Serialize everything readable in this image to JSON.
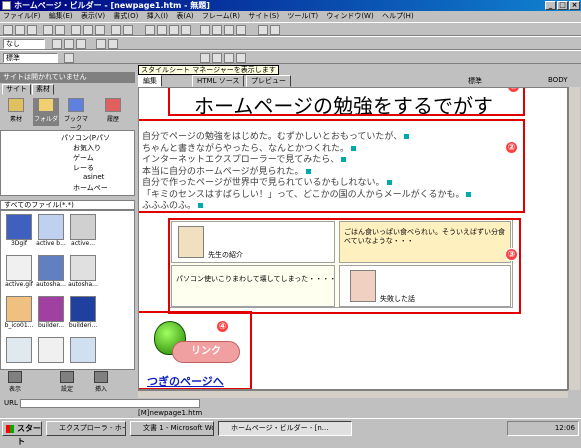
{
  "window": {
    "title": "ホームページ・ビルダー - [newpage1.htm - 無題]",
    "min_label": "_",
    "max_label": "□",
    "close_label": "×"
  },
  "menu": [
    "ファイル(F)",
    "編集(E)",
    "表示(V)",
    "書式(O)",
    "挿入(I)",
    "表(A)",
    "フレーム(R)",
    "サイト(S)",
    "ツール(T)",
    "ウィンドウ(W)",
    "ヘルプ(H)"
  ],
  "toolbar": {
    "style_select": "なし",
    "font_select": "標準",
    "tooltip": "スタイルシート マネージャーを表示します"
  },
  "sidebar": {
    "header": "サイトは開かれていません",
    "tabs": [
      "サイト",
      "素材"
    ],
    "icons": [
      "素材",
      "フォルダ",
      "ブックマーク",
      "履歴"
    ],
    "tree": [
      "パソコン(Pパソ",
      "お気入り",
      "ゲーム",
      "レーる",
      "asinet",
      "ホームペー"
    ],
    "filter": "すべてのファイル(*.*)",
    "files": [
      "3Dgif",
      "active b...",
      "active...",
      "active.gif",
      "autosha...",
      "autosha...",
      "b_ico01...",
      "builder...",
      "builderi...",
      "",
      "",
      ""
    ],
    "bottom_buttons": [
      "表示",
      "設定",
      "挿入"
    ]
  },
  "doc_tabs": [
    "編集",
    "HTML ソース",
    "プレビュー"
  ],
  "doc_tab_right": [
    "標準",
    "BODY"
  ],
  "document": {
    "heading": "ホームページの勉強をするでがす",
    "paragraph": [
      "自分でページの勉強をはじめた。むずかしいとおもっていたが、",
      "ちゃんと書きながらやったら、なんとかつくれた。",
      "インターネットエクスプローラーで見てみたら、",
      "本当に自分のホームページが見られた。",
      "自分で作ったページが世界中で見られているかもしれない。",
      "「キミのセンスはすばらしい！」って、どこかの国の人からメールがくるかも。",
      "ふふふのふ。"
    ],
    "table_cells": [
      "先生の紹介",
      "ごはん食いっぱい食べられい。そういえばずい分食べていなような・・・",
      "パソコン使いこりまわして壊してしまった・・・・",
      "失敗した話"
    ],
    "link_button": "リンク",
    "link_text": "つぎのページへ"
  },
  "annotations": [
    "①",
    "②",
    "③",
    "④"
  ],
  "status": {
    "url_label": "URL",
    "path": "[M]newpage1.htm"
  },
  "taskbar": {
    "start": "スタート",
    "tasks": [
      "エクスプローラ - ホームペー",
      "文書 1 - Microsoft Word",
      "ホームページ・ビルダー - [n..."
    ],
    "clock": "12:06"
  },
  "colors": {
    "title_gradient_start": "#000080",
    "annotation_red": "#e00000",
    "link_blue": "#1020c0"
  }
}
